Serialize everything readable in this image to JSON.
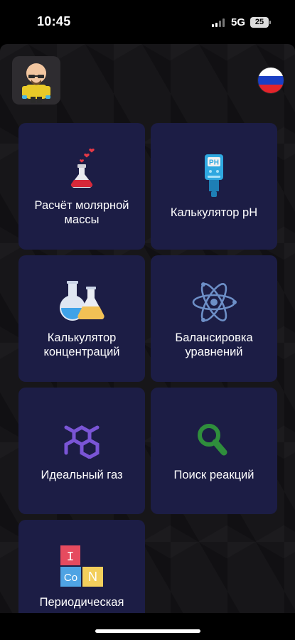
{
  "status_bar": {
    "time": "10:45",
    "network": "5G",
    "battery": "25"
  },
  "header": {
    "avatar": "walter-white-avatar-icon",
    "language_flag": "russian-flag-icon"
  },
  "menu": {
    "items": [
      {
        "label": "Расчёт молярной\nмассы",
        "icon": "flask-hearts-icon"
      },
      {
        "label": "Калькулятор pH",
        "icon": "ph-meter-icon"
      },
      {
        "label": "Калькулятор\nконцентраций",
        "icon": "flasks-icon"
      },
      {
        "label": "Балансировка\nуравнений",
        "icon": "atom-icon"
      },
      {
        "label": "Идеальный газ",
        "icon": "molecule-icon"
      },
      {
        "label": "Поиск реакций",
        "icon": "magnifier-icon"
      },
      {
        "label": "Периодическая",
        "icon": "periodic-elements-icon",
        "element_letters": [
          "I",
          "Co",
          "N"
        ]
      }
    ]
  },
  "colors": {
    "card_bg": "#1c1d45",
    "app_bg": "#171619"
  }
}
